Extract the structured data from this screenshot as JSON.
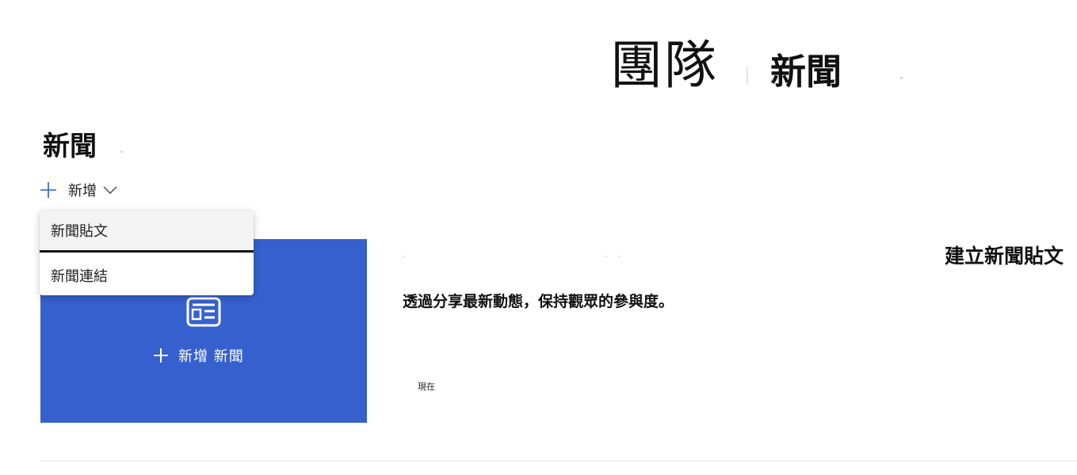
{
  "header": {
    "site_name": "團隊",
    "page_name": "新聞"
  },
  "news_section": {
    "title": "新聞",
    "add_button_label": "新增",
    "add_menu": {
      "items": [
        {
          "label": "新聞貼文"
        },
        {
          "label": "新聞連結"
        }
      ]
    },
    "tile": {
      "icon": "news-icon",
      "add_label": "新增 新聞",
      "background_color": "#3660ce"
    },
    "placeholder_post": {
      "title": "建立新聞貼文",
      "description": "透過分享最新動態，保持觀眾的參與度。",
      "time": "現在"
    }
  },
  "colors": {
    "accent": "#3660ce",
    "icon_blue": "#2f5cc9"
  }
}
